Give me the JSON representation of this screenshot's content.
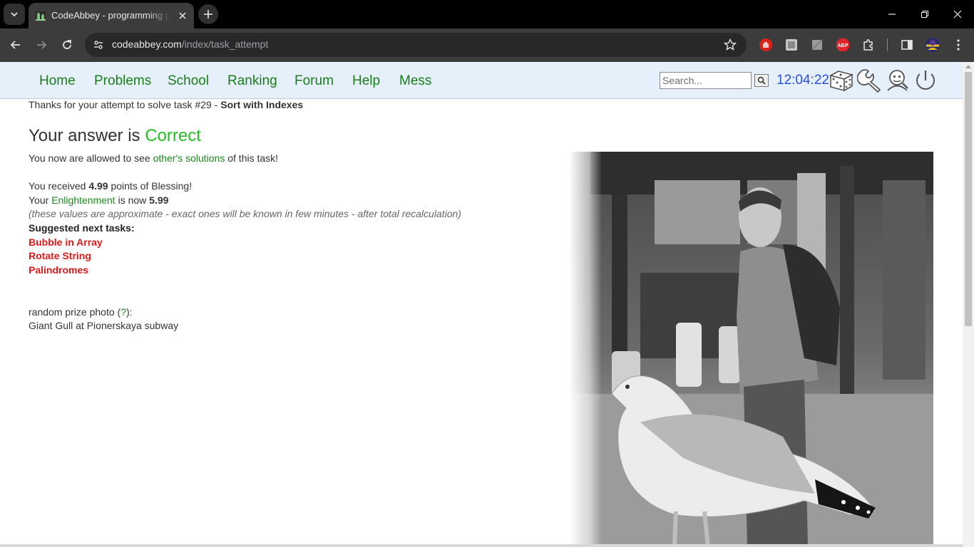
{
  "browser": {
    "tab_title": "CodeAbbey - programming problems",
    "url_domain": "codeabbey.com",
    "url_path": "/index/task_attempt"
  },
  "nav": {
    "links": [
      "Home",
      "Problems",
      "School",
      "Ranking",
      "Forum",
      "Help",
      "Mess"
    ],
    "search_placeholder": "Search...",
    "clock": "12:04:22",
    "icons": [
      "dice-icon",
      "wrench-icon",
      "user-search-icon",
      "power-icon"
    ]
  },
  "content": {
    "thanks_prefix": "Thanks for your attempt to solve task #29 - ",
    "task_name": "Sort with Indexes",
    "answer_prefix": "Your answer is ",
    "answer_result": "Correct",
    "allowed_prefix": "You now are allowed to see ",
    "allowed_link": "other's solutions",
    "allowed_suffix": " of this task!",
    "received_prefix": "You received ",
    "received_points": "4.99",
    "received_suffix": " points of Blessing!",
    "enlight_prefix": "Your ",
    "enlight_link": "Enlightenment",
    "enlight_mid": " is now ",
    "enlight_value": "5.99",
    "approx_note": "(these values are approximate - exact ones will be known in few minutes - after total recalculation)",
    "suggest_heading": "Suggested next tasks:",
    "suggested_tasks": [
      "Bubble in Array",
      "Rotate String",
      "Palindromes"
    ],
    "photo_prefix": "random prize photo (",
    "photo_help": "?",
    "photo_suffix": "):",
    "photo_caption": "Giant Gull at Pionerskaya subway"
  },
  "colors": {
    "nav_bg": "#e6f0fb",
    "nav_link": "#1a7d1a",
    "correct": "#26c026",
    "task_link": "#e01a1a",
    "clock": "#2b4fe0"
  }
}
